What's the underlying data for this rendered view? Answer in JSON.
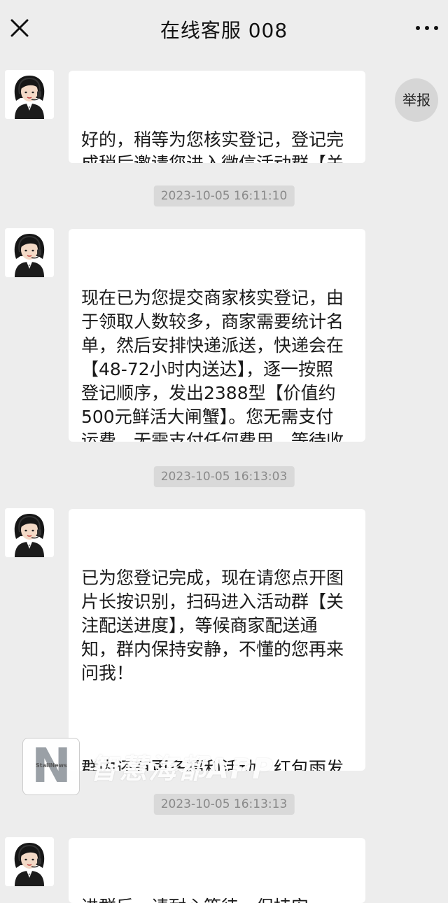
{
  "header": {
    "title": "在线客服 008",
    "close_icon": "close-icon",
    "more_icon": "more-icon"
  },
  "report_label": "举报",
  "messages": [
    {
      "paragraphs": [
        "好的，稍等为您核实登记，登记完成稍后邀请您进入微信活动群【关注配送进度】"
      ]
    },
    {
      "paragraphs": [
        "现在已为您提交商家核实登记，由于领取人数较多，商家需要统计名单，然后安排快递派送，快递会在【48-72小时内送达】，逐一按照登记顺序，发出2388型【价值约500元鲜活大闸蟹】。您无需支付运费，无需支付任何费用，等待收货即可！"
      ]
    },
    {
      "paragraphs": [
        "已为您登记完成，现在请您点开图片长按识别，扫码进入活动群【关注配送进度】，等候商家配送通知，群内保持安静，不懂的您再来问我！",
        "群内还有更多福利活动，红包雨发放，有空您也可以参与，也是会有奖励的，非常感谢您的支持与信任！"
      ]
    },
    {
      "paragraphs": [
        "进群后，请耐心等待，保持安"
      ]
    }
  ],
  "timestamps": [
    "2023-10-05 16:11:10",
    "2023-10-05 16:13:03",
    "2023-10-05 16:13:13"
  ],
  "watermark": {
    "logo_letter": "N",
    "logo_small_text": "StaiiNews",
    "text": "智慧海都APP"
  }
}
